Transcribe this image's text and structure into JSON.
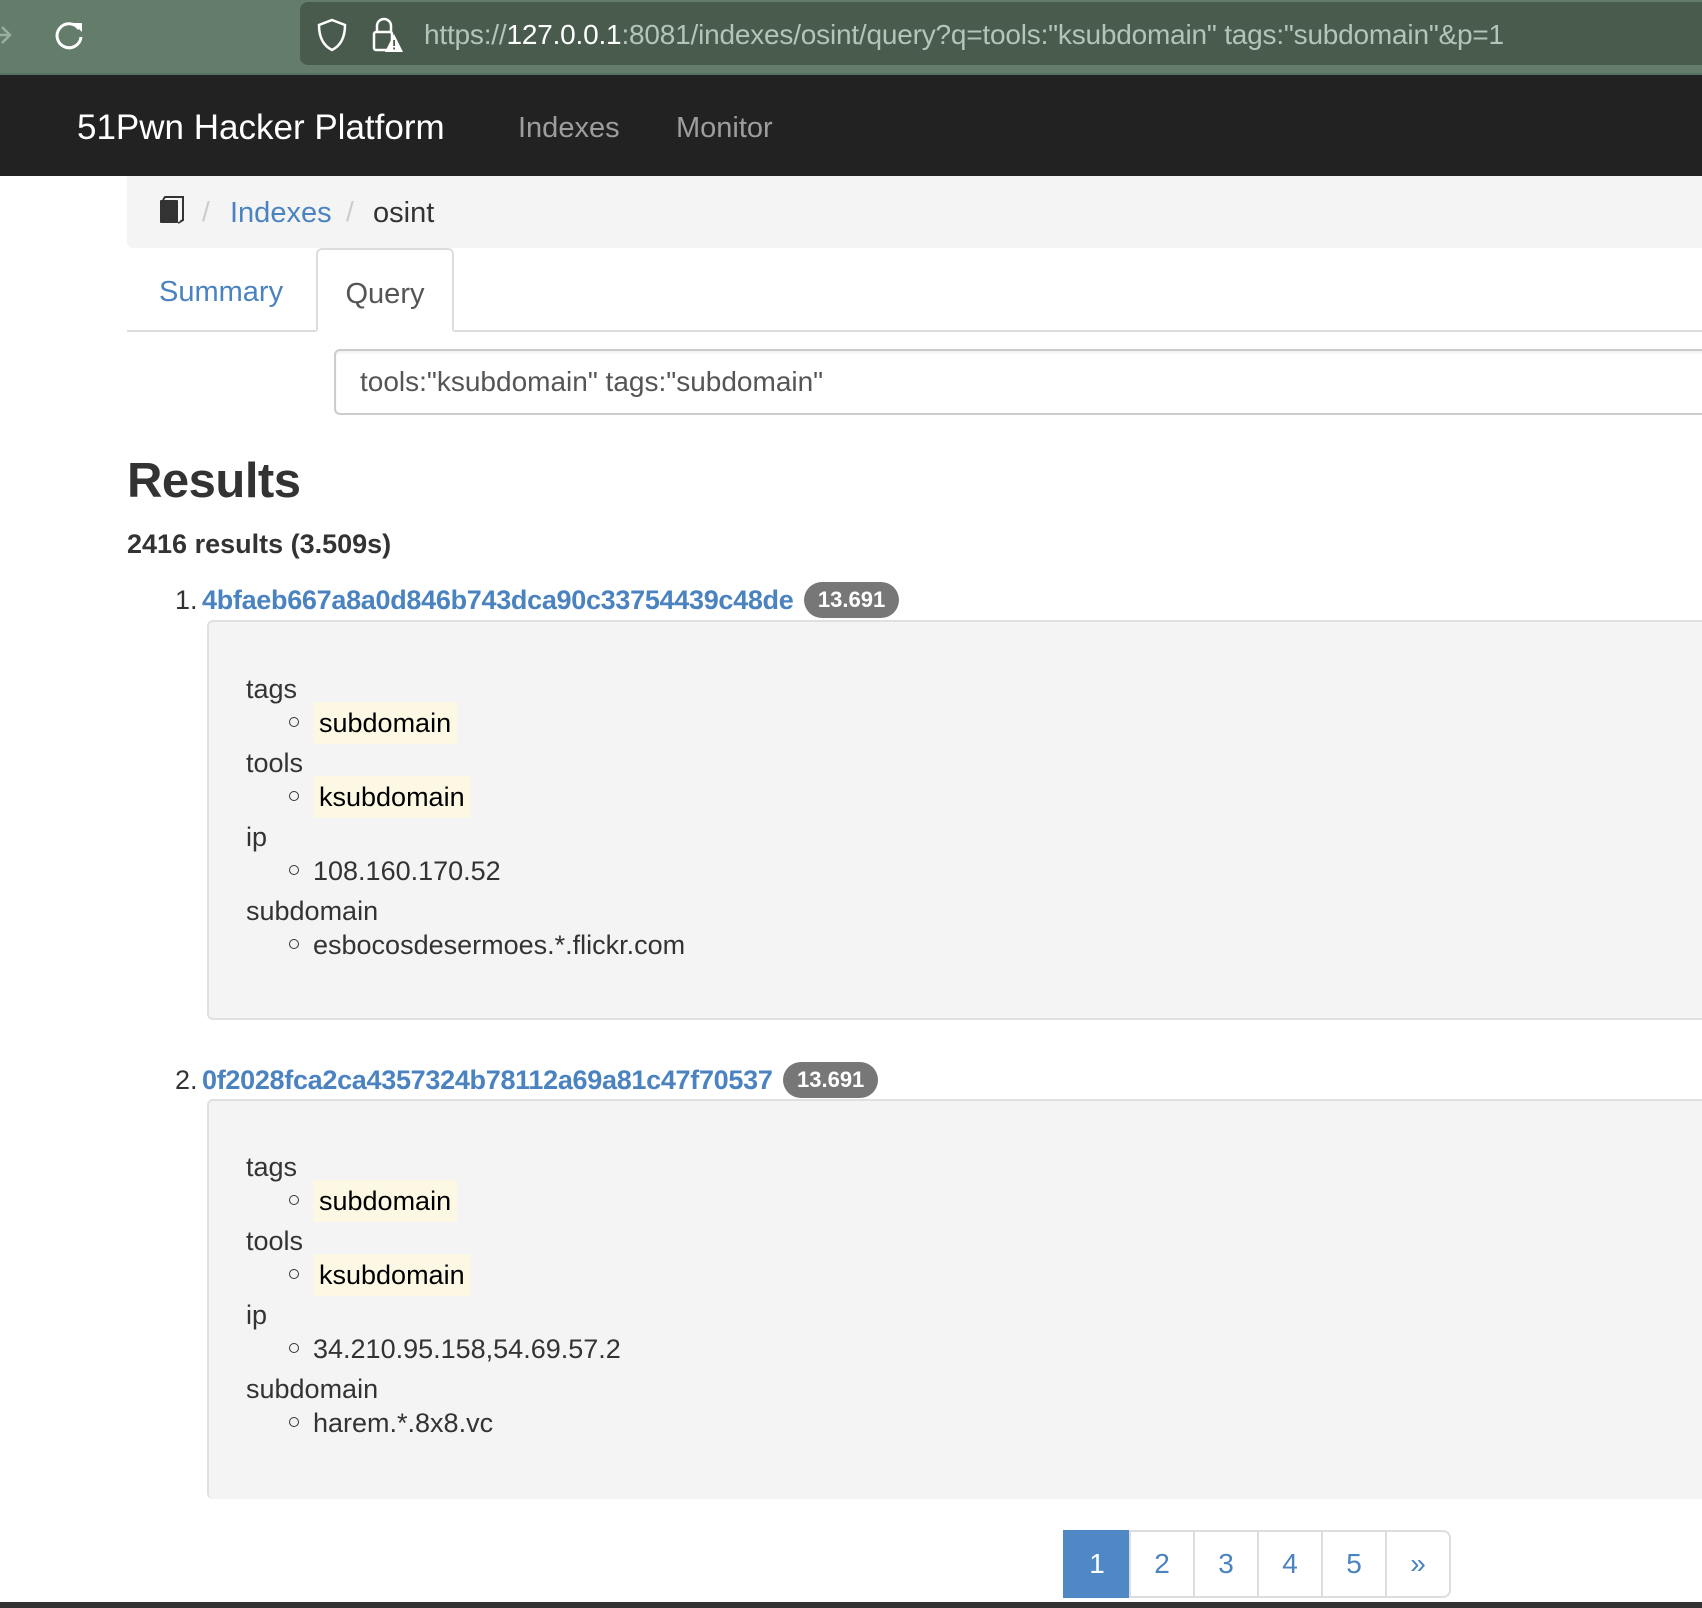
{
  "browser": {
    "url_prefix": "https://",
    "url_host": "127.0.0.1",
    "url_rest": ":8081/indexes/osint/query?q=tools:\"ksubdomain\" tags:\"subdomain\"&p=1"
  },
  "navbar": {
    "brand": "51Pwn Hacker Platform",
    "links": [
      {
        "label": "Indexes"
      },
      {
        "label": "Monitor"
      }
    ]
  },
  "breadcrumb": {
    "separator": "/",
    "items": [
      {
        "label": "Indexes"
      },
      {
        "label": "osint"
      }
    ]
  },
  "tabs": [
    {
      "label": "Summary",
      "active": false
    },
    {
      "label": "Query",
      "active": true
    }
  ],
  "query": {
    "value": "tools:\"ksubdomain\" tags:\"subdomain\""
  },
  "results": {
    "heading": "Results",
    "count_text": "2416 results (3.509s)",
    "items": [
      {
        "num": "1.",
        "id": "4bfaeb667a8a0d846b743dca90c33754439c48de",
        "score": "13.691",
        "fields": [
          {
            "name": "tags",
            "value": "subdomain",
            "highlight": true
          },
          {
            "name": "tools",
            "value": "ksubdomain",
            "highlight": true
          },
          {
            "name": "ip",
            "value": "108.160.170.52",
            "highlight": false
          },
          {
            "name": "subdomain",
            "value": "esbocosdesermoes.*.flickr.com",
            "highlight": false
          }
        ]
      },
      {
        "num": "2.",
        "id": "0f2028fca2ca4357324b78112a69a81c47f70537",
        "score": "13.691",
        "fields": [
          {
            "name": "tags",
            "value": "subdomain",
            "highlight": true
          },
          {
            "name": "tools",
            "value": "ksubdomain",
            "highlight": true
          },
          {
            "name": "ip",
            "value": "34.210.95.158,54.69.57.2",
            "highlight": false
          },
          {
            "name": "subdomain",
            "value": "harem.*.8x8.vc",
            "highlight": false
          }
        ]
      }
    ]
  },
  "pagination": {
    "pages": [
      "1",
      "2",
      "3",
      "4",
      "5"
    ],
    "current": "1",
    "next_label": "»"
  },
  "colors": {
    "link": "#4a83c0",
    "navbar_bg": "#222222",
    "badge_bg": "#777777",
    "highlight_bg": "#fcf8e3",
    "page_active_bg": "#5088c5"
  }
}
